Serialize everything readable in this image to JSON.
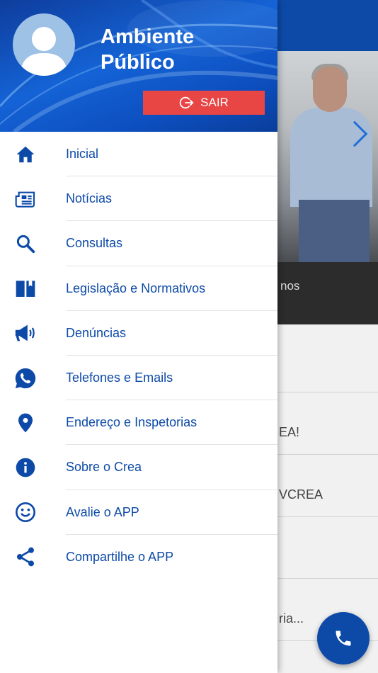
{
  "background": {
    "caption_fragment": "nos",
    "list_fragments": [
      "EA!",
      "VCREA",
      "ria..."
    ]
  },
  "drawer": {
    "user_name": "Ambiente Público",
    "logout_label": "SAIR",
    "menu": [
      {
        "label": "Inicial",
        "icon": "home-icon"
      },
      {
        "label": "Notícias",
        "icon": "newspaper-icon"
      },
      {
        "label": "Consultas",
        "icon": "search-icon"
      },
      {
        "label": "Legislação e Normativos",
        "icon": "book-icon"
      },
      {
        "label": "Denúncias",
        "icon": "megaphone-icon"
      },
      {
        "label": "Telefones e Emails",
        "icon": "whatsapp-icon"
      },
      {
        "label": "Endereço e Inspetorias",
        "icon": "location-pin-icon"
      },
      {
        "label": "Sobre o Crea",
        "icon": "info-icon"
      },
      {
        "label": "Avalie o APP",
        "icon": "smiley-icon"
      },
      {
        "label": "Compartilhe o APP",
        "icon": "share-icon"
      }
    ]
  },
  "colors": {
    "primary": "#0d4aa8",
    "logout": "#e84545",
    "header_gradient_start": "#0e3d9c",
    "header_gradient_mid": "#1463d6"
  }
}
